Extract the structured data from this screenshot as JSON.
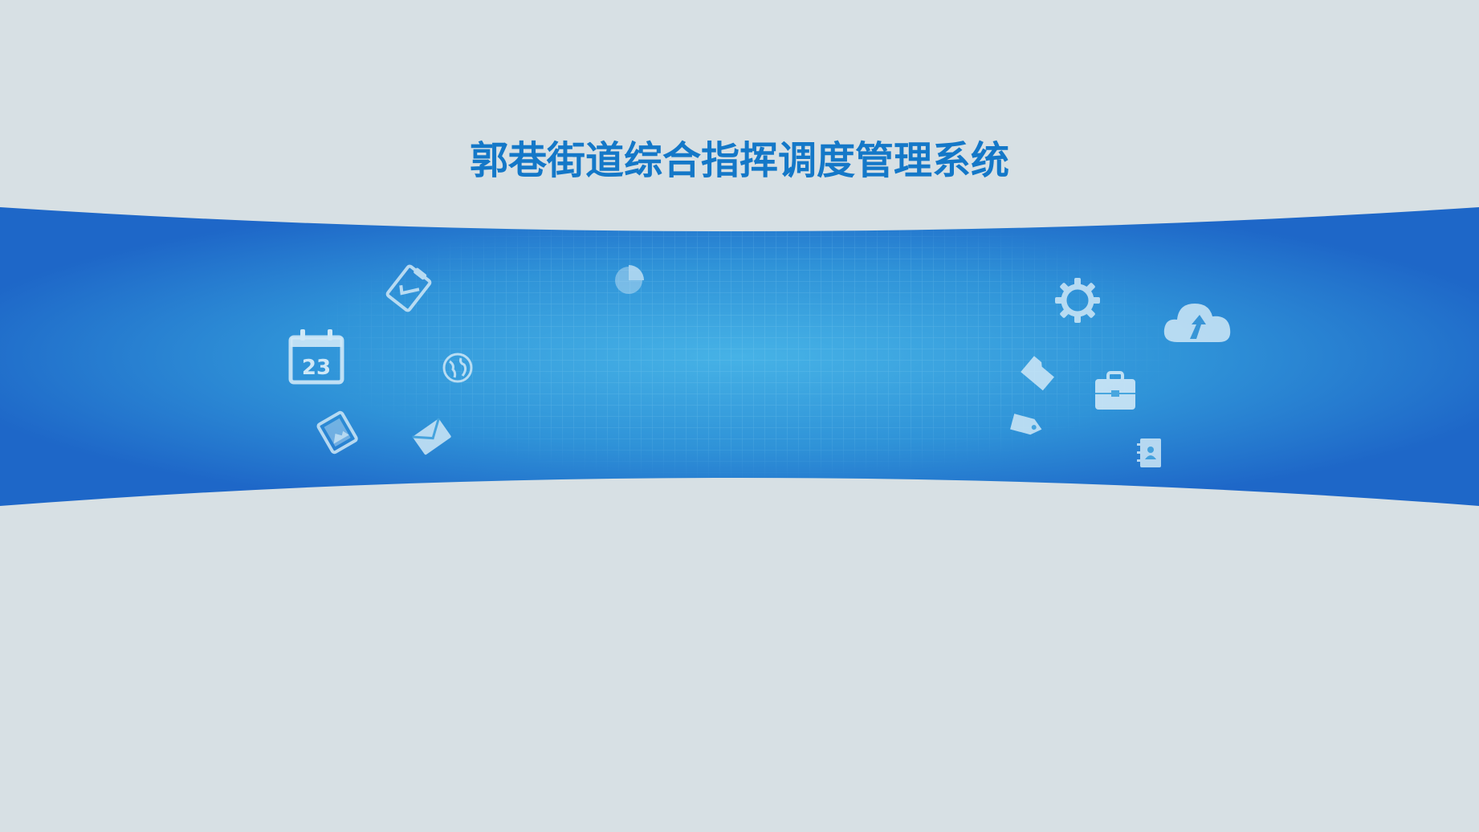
{
  "header": {
    "title": "郭巷街道综合指挥调度管理系统"
  },
  "banner": {
    "calendar_day": "23",
    "icons": [
      "calendar-icon",
      "clipboard-check-icon",
      "photo-gallery-icon",
      "globe-icon",
      "envelope-icon",
      "pie-chart-icon",
      "gear-icon",
      "cloud-upload-icon",
      "folder-icon",
      "briefcase-icon",
      "tag-icon",
      "contact-book-icon"
    ]
  },
  "colors": {
    "background": "#d7e0e4",
    "title": "#1478c8",
    "band_edge": "#1f6fcc",
    "band_center": "#3aa2de"
  }
}
